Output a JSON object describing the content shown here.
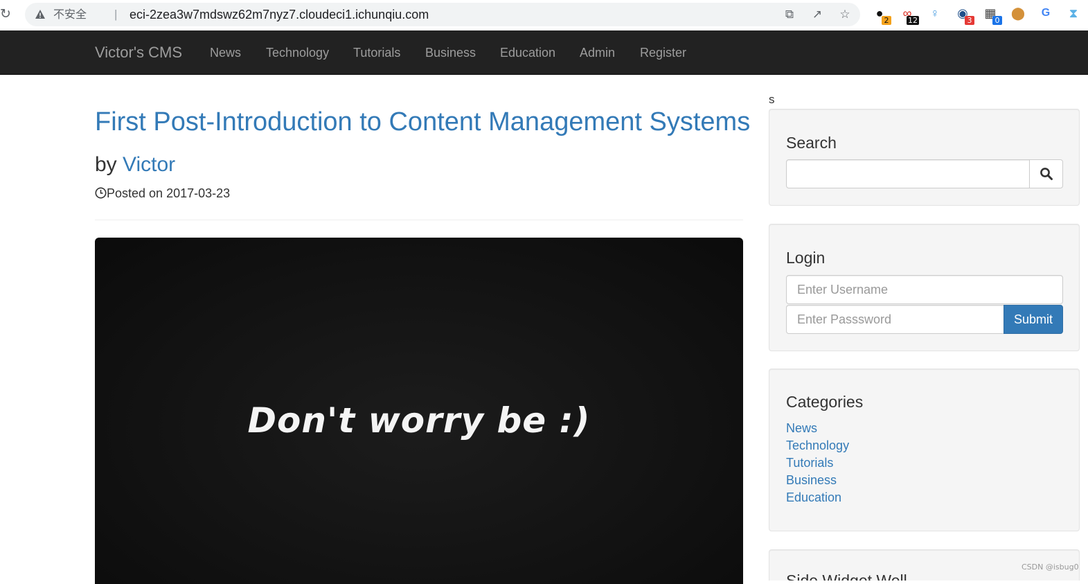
{
  "browser": {
    "insecure_label": "不安全",
    "separator": "|",
    "url": "eci-2zea3w7mdswz62m7nyz7.cloudeci1.ichunqiu.com",
    "extensions": [
      {
        "icon": "circle-ext-icon",
        "badge": "2",
        "badge_color": "#f4a21c"
      },
      {
        "icon": "link-ext-icon",
        "badge": "12",
        "badge_color": "#111111"
      },
      {
        "icon": "pin-ext-icon",
        "badge": ""
      },
      {
        "icon": "globe-ext-icon",
        "badge": "3",
        "badge_color": "#e53935"
      },
      {
        "icon": "qr-ext-icon",
        "badge": "0",
        "badge_color": "#1a73e8"
      },
      {
        "icon": "cookie-ext-icon",
        "badge": ""
      },
      {
        "icon": "google-translate-ext-icon",
        "badge": ""
      },
      {
        "icon": "hourglass-ext-icon",
        "badge": ""
      }
    ]
  },
  "navbar": {
    "brand": "Victor's CMS",
    "links": [
      "News",
      "Technology",
      "Tutorials",
      "Business",
      "Education",
      "Admin",
      "Register"
    ]
  },
  "post": {
    "title": "First Post-Introduction to Content Management Systems",
    "by_label": "by",
    "author": "Victor",
    "posted_label": "Posted on 2017-03-23",
    "image_text": "Don't worry be :)"
  },
  "sidebar": {
    "stray_text": "s",
    "search": {
      "title": "Search",
      "value": ""
    },
    "login": {
      "title": "Login",
      "username_placeholder": "Enter Username",
      "password_placeholder": "Enter Passsword",
      "submit_label": "Submit"
    },
    "categories": {
      "title": "Categories",
      "items": [
        "News",
        "Technology",
        "Tutorials",
        "Business",
        "Education"
      ]
    },
    "widget": {
      "title": "Side Widget Well"
    }
  },
  "watermark": "CSDN @isbug0",
  "colors": {
    "link": "#337ab7",
    "navbar_bg": "#222222",
    "navbar_text": "#9d9d9d",
    "well_bg": "#f5f5f5"
  }
}
